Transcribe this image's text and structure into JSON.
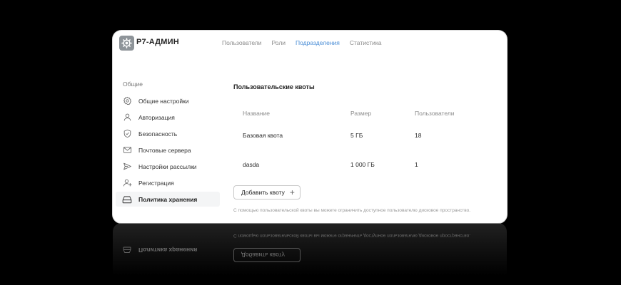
{
  "app": {
    "title": "Р7-АДМИН"
  },
  "nav": {
    "tabs": [
      {
        "label": "Пользователи"
      },
      {
        "label": "Роли"
      },
      {
        "label": "Подразделения"
      },
      {
        "label": "Статистика"
      }
    ],
    "active_index": 2
  },
  "sidebar": {
    "heading": "Общие",
    "items": [
      {
        "label": "Общие настройки",
        "icon": "gear-icon"
      },
      {
        "label": "Авторизация",
        "icon": "user-icon"
      },
      {
        "label": "Безопасность",
        "icon": "shield-icon"
      },
      {
        "label": "Почтовые сервера",
        "icon": "mail-icon"
      },
      {
        "label": "Настройки рассылки",
        "icon": "send-icon"
      },
      {
        "label": "Регистрация",
        "icon": "user-plus-icon"
      },
      {
        "label": "Политика хранения",
        "icon": "storage-icon"
      }
    ],
    "active_index": 6
  },
  "main": {
    "title": "Пользовательские квоты",
    "columns": [
      "Название",
      "Размер",
      "Пользователи"
    ],
    "rows": [
      {
        "name": "Базовая квота",
        "size": "5 ГБ",
        "users": "18"
      },
      {
        "name": "dasda",
        "size": "1 000 ГБ",
        "users": "1"
      }
    ],
    "add_button_label": "Добавить квоту",
    "hint": "С помощью пользовательской квоты вы можете ограничить доступное пользователю дисковое пространство."
  },
  "colors": {
    "accent": "#4b8ed6",
    "background": "#000000",
    "panel": "#ffffff"
  }
}
